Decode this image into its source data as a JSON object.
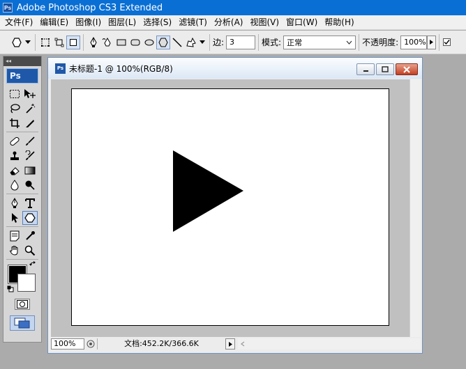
{
  "app": {
    "title": "Adobe Photoshop CS3 Extended",
    "logo_text": "Ps"
  },
  "menu": [
    "文件(F)",
    "编辑(E)",
    "图像(I)",
    "图层(L)",
    "选择(S)",
    "滤镜(T)",
    "分析(A)",
    "视图(V)",
    "窗口(W)",
    "帮助(H)"
  ],
  "options": {
    "sides_label": "边:",
    "sides_value": "3",
    "mode_label": "模式:",
    "mode_value": "正常",
    "opacity_label": "不透明度:",
    "opacity_value": "100%"
  },
  "toolbox": {
    "badge": "Ps",
    "grip": "◂◂"
  },
  "document": {
    "title": "未标题-1 @ 100%(RGB/8)",
    "icon_text": "Ps",
    "zoom": "100%",
    "doc_info": "文档:452.2K/366.6K",
    "shape": {
      "type": "triangle",
      "fill": "#000000"
    }
  },
  "colors": {
    "titlebar": "#0a6fd4",
    "foreground": "#000000",
    "background": "#ffffff"
  }
}
